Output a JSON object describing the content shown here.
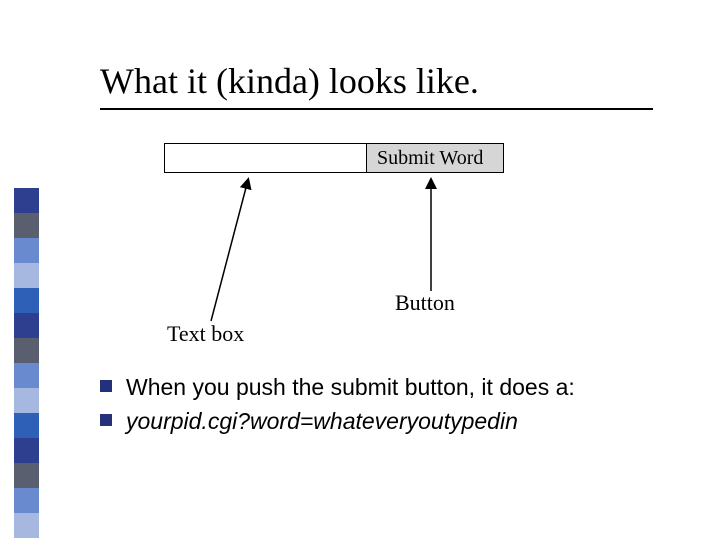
{
  "title": "What it (kinda) looks like.",
  "form": {
    "textbox_value": "",
    "submit_label": "Submit Word"
  },
  "annotations": {
    "button": "Button",
    "textbox": "Text box"
  },
  "bullets": [
    {
      "text": "When you push the submit button, it does a:",
      "italic": false
    },
    {
      "text": "yourpid.cgi?word=whateveryoutypedin",
      "italic": true
    }
  ],
  "sidebar_colors": [
    "#2f3f8f",
    "#5a5f70",
    "#6a8ad0",
    "#a6b7e0",
    "#2f60b7",
    "#2f3f8f",
    "#5a5f70",
    "#6a8ad0",
    "#a6b7e0",
    "#2f60b7",
    "#2f3f8f",
    "#5a5f70",
    "#6a8ad0",
    "#a6b7e0"
  ]
}
